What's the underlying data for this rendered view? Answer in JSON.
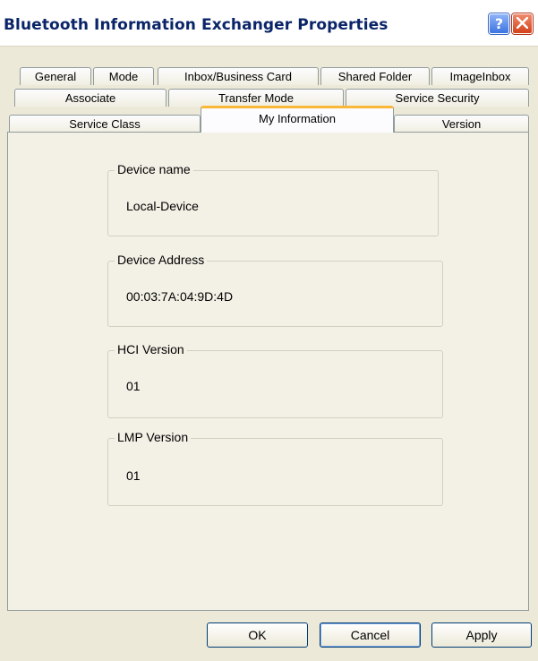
{
  "window": {
    "title": "Bluetooth Information Exchanger Properties",
    "help_glyph": "?",
    "icons": {
      "help": "help-icon",
      "close": "close-x-icon"
    }
  },
  "tabs": {
    "row1": [
      "General",
      "Mode",
      "Inbox/Business Card",
      "Shared Folder",
      "ImageInbox"
    ],
    "row2": [
      "Associate",
      "Transfer Mode",
      "Service Security"
    ],
    "row3": [
      "Service Class",
      "My Information",
      "Version"
    ],
    "active": "My Information"
  },
  "groups": [
    {
      "label": "Device name",
      "value": "Local-Device"
    },
    {
      "label": "Device Address",
      "value": "00:03:7A:04:9D:4D"
    },
    {
      "label": "HCI Version",
      "value": "01"
    },
    {
      "label": "LMP Version",
      "value": "01"
    }
  ],
  "buttons": {
    "ok": "OK",
    "cancel": "Cancel",
    "apply": "Apply"
  },
  "colors": {
    "title_text": "#0a2468",
    "active_tab_accent": "#f9b83a",
    "close_button": "#d4421a",
    "help_button": "#3c74e0"
  }
}
